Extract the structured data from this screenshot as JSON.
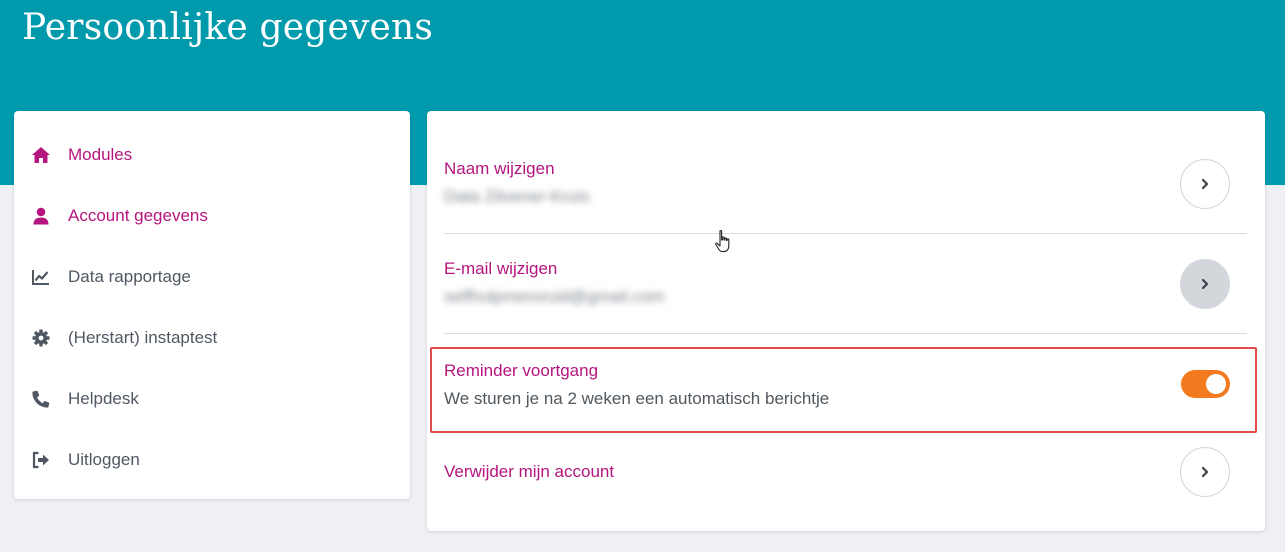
{
  "page": {
    "title": "Persoonlijke gegevens"
  },
  "sidebar": {
    "items": [
      {
        "label": "Modules",
        "icon": "home-icon",
        "active": true
      },
      {
        "label": "Account gegevens",
        "icon": "user-icon",
        "active": true
      },
      {
        "label": "Data rapportage",
        "icon": "chart-line-icon",
        "active": false
      },
      {
        "label": "(Herstart) instaptest",
        "icon": "gear-icon",
        "active": false
      },
      {
        "label": "Helpdesk",
        "icon": "phone-icon",
        "active": false
      },
      {
        "label": "Uitloggen",
        "icon": "sign-out-icon",
        "active": false
      }
    ]
  },
  "settings": {
    "name": {
      "label": "Naam wijzigen",
      "value": "Data Zilvener-Kruis"
    },
    "email": {
      "label": "E-mail wijzigen",
      "value": "selfhulpmeroruid@gmail.com"
    },
    "reminder": {
      "label": "Reminder voortgang",
      "description": "We sturen je na 2 weken een automatisch berichtje",
      "enabled": true
    },
    "delete": {
      "label": "Verwijder mijn account"
    }
  },
  "colors": {
    "header": "#019aad",
    "accent": "#b5157e",
    "toggle_on": "#f47a1f",
    "highlight": "#e04a4a"
  }
}
